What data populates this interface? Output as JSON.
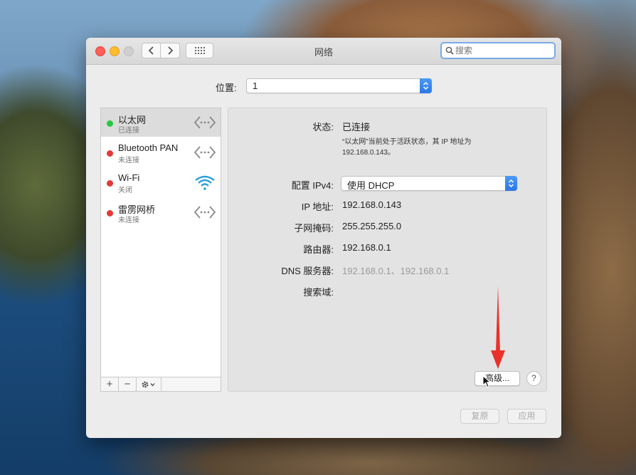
{
  "window": {
    "title": "网络"
  },
  "search": {
    "placeholder": "搜索"
  },
  "location": {
    "label": "位置:",
    "value": "1"
  },
  "services": [
    {
      "name": "以太网",
      "status": "已连接",
      "status_color": "#28c840",
      "icon": "ethernet-icon"
    },
    {
      "name": "Bluetooth PAN",
      "status": "未连接",
      "status_color": "#e23b37",
      "icon": "ethernet-icon"
    },
    {
      "name": "Wi-Fi",
      "status": "关闭",
      "status_color": "#e23b37",
      "icon": "wifi-icon"
    },
    {
      "name": "雷雳网桥",
      "status": "未连接",
      "status_color": "#e23b37",
      "icon": "ethernet-icon"
    }
  ],
  "sidebar_toolbar": {
    "add": "+",
    "remove": "−",
    "action": "action-gear-icon"
  },
  "detail": {
    "status_label": "状态:",
    "status_value": "已连接",
    "status_desc": "“以太网”当前处于活跃状态，其 IP 地址为 192.168.0.143。",
    "configure_label": "配置 IPv4:",
    "configure_value": "使用 DHCP",
    "ip_label": "IP 地址:",
    "ip_value": "192.168.0.143",
    "subnet_label": "子网掩码:",
    "subnet_value": "255.255.255.0",
    "router_label": "路由器:",
    "router_value": "192.168.0.1",
    "dns_label": "DNS 服务器:",
    "dns_value": "192.168.0.1、192.168.0.1",
    "search_domain_label": "搜索域:",
    "advanced_button": "高级...",
    "help_button": "?"
  },
  "footer": {
    "revert_button": "复原",
    "apply_button": "应用"
  },
  "colors": {
    "accent": "#2c77e6",
    "annotation_arrow": "#e8322b"
  }
}
